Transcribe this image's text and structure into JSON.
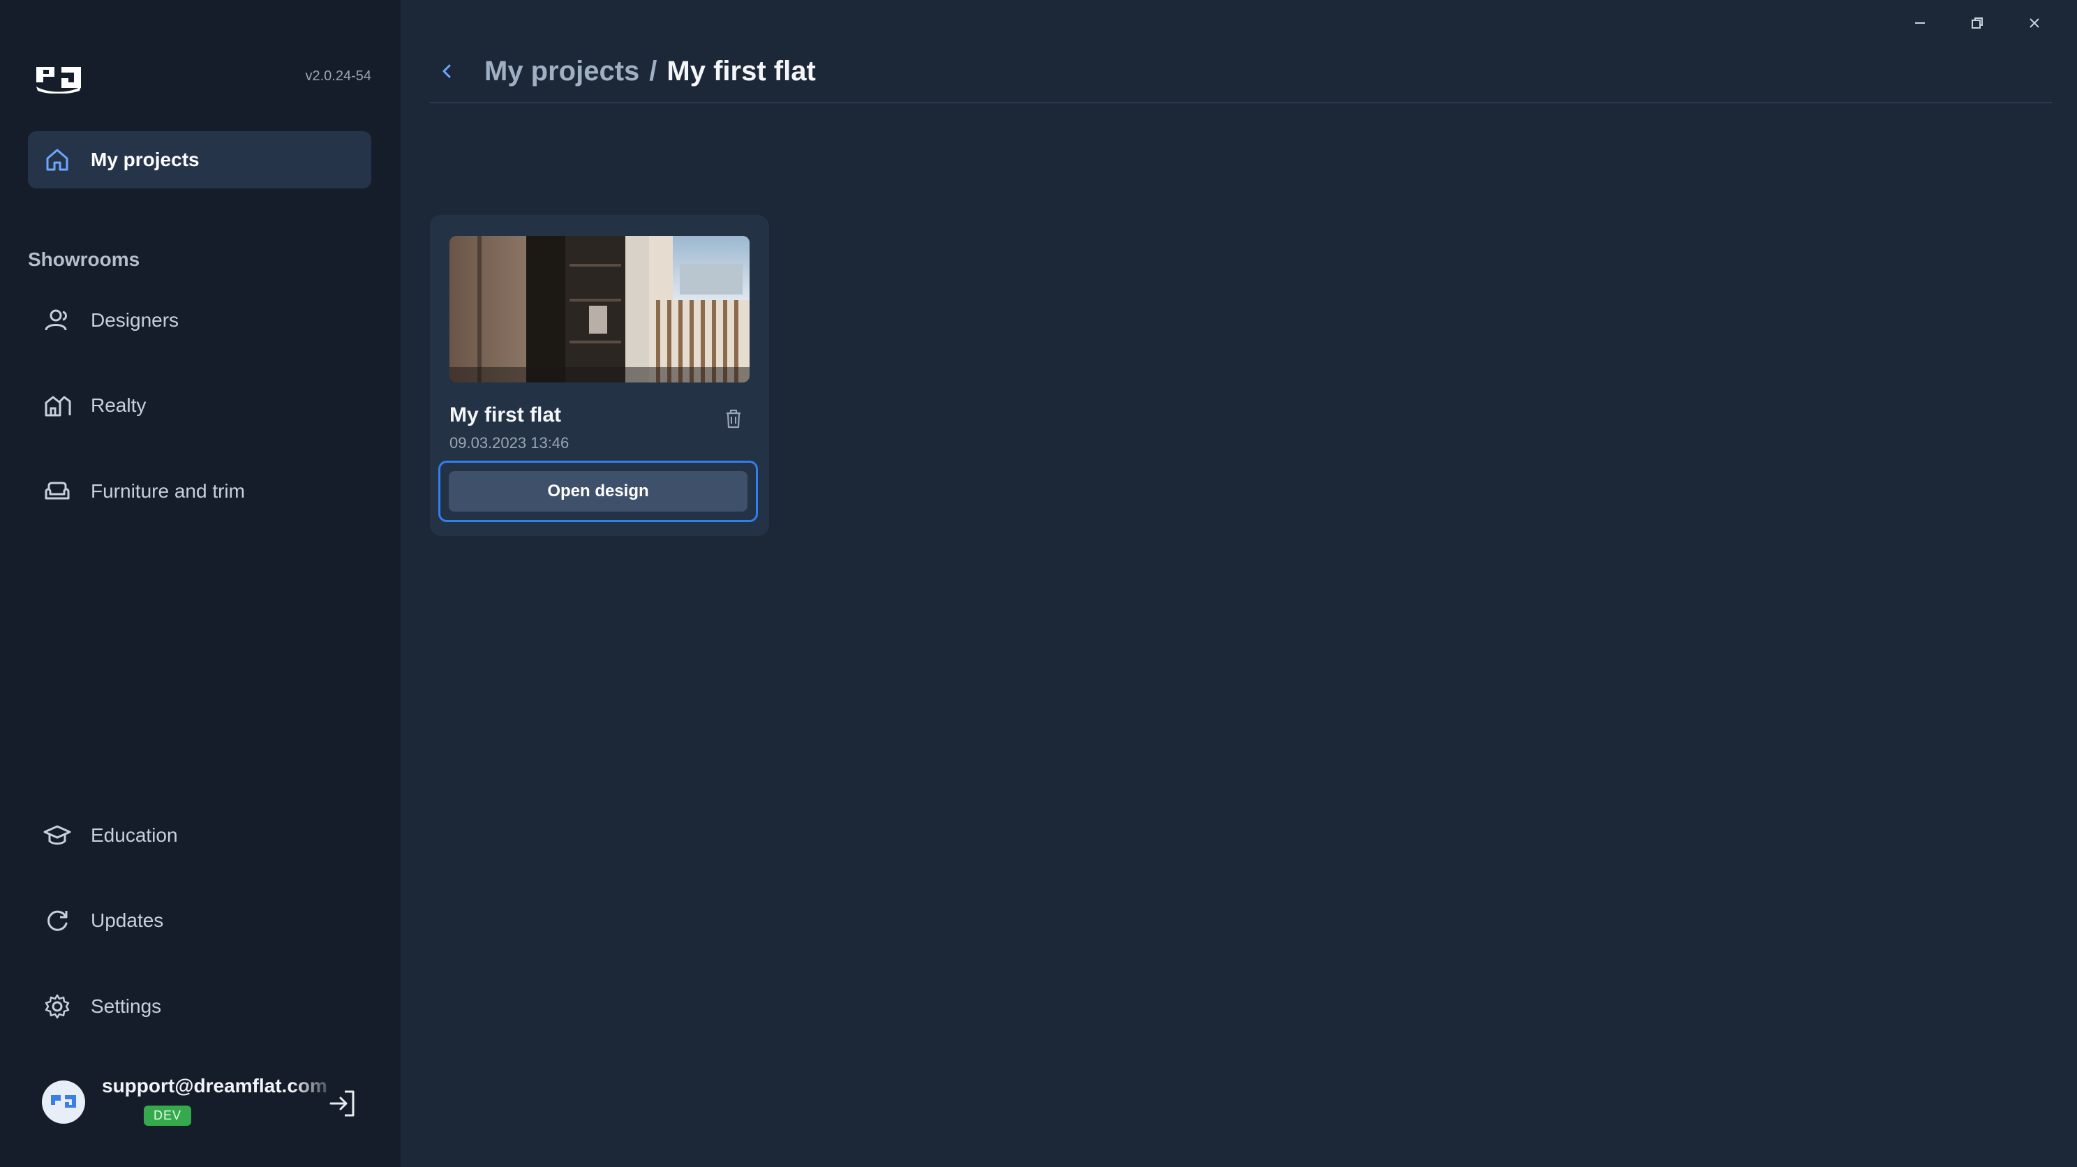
{
  "app": {
    "version": "v2.0.24-54"
  },
  "sidebar": {
    "primary": {
      "label": "My projects",
      "icon": "home-icon"
    },
    "section_title": "Showrooms",
    "showrooms": [
      {
        "label": "Designers",
        "icon": "users-icon"
      },
      {
        "label": "Realty",
        "icon": "buildings-icon"
      },
      {
        "label": "Furniture and trim",
        "icon": "sofa-icon"
      }
    ],
    "bottom": [
      {
        "label": "Education",
        "icon": "graduation-cap-icon"
      },
      {
        "label": "Updates",
        "icon": "refresh-icon"
      },
      {
        "label": "Settings",
        "icon": "gear-icon"
      }
    ],
    "user": {
      "email": "support@dreamflat.com",
      "badge": "DEV"
    }
  },
  "header": {
    "breadcrumb_parent": "My projects",
    "breadcrumb_separator": "/",
    "breadcrumb_current": "My first flat"
  },
  "project": {
    "title": "My first flat",
    "date": "09.03.2023 13:46",
    "open_label": "Open design"
  },
  "colors": {
    "background": "#1c2838",
    "sidebar": "#141d29",
    "accent": "#2f7ff0",
    "dev_badge": "#35a94b"
  }
}
